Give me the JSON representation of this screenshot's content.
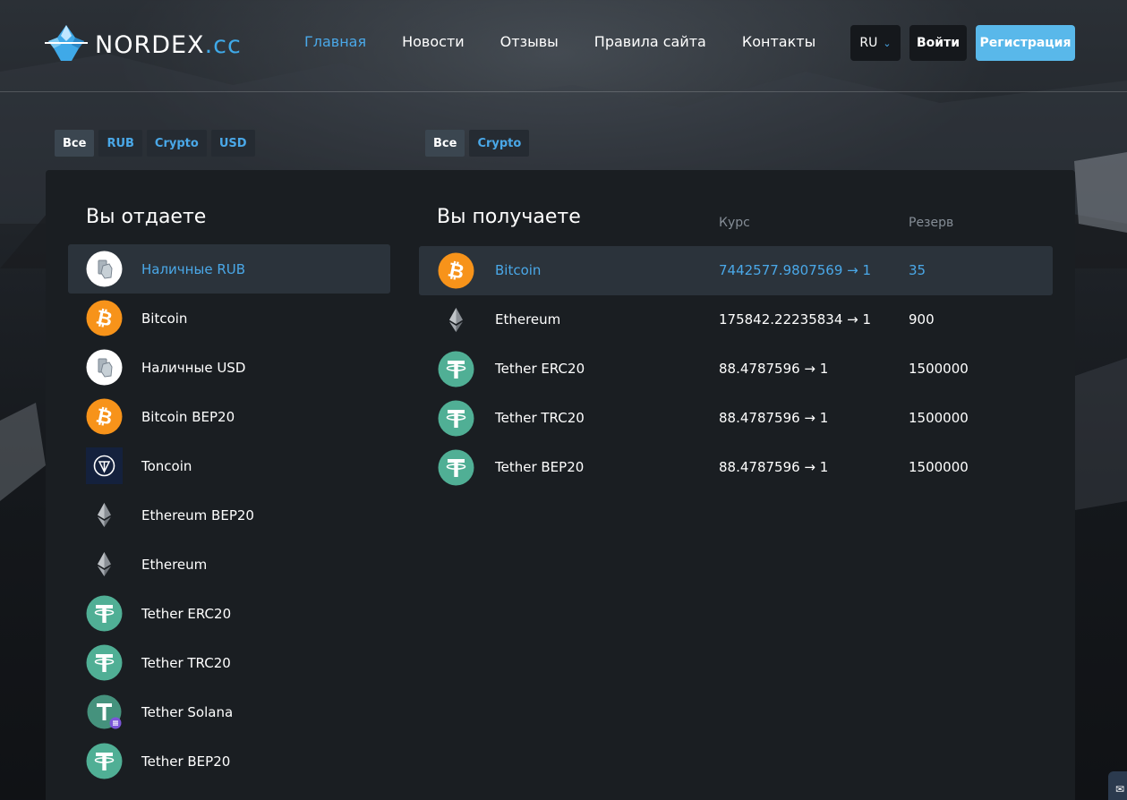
{
  "header": {
    "logo_main": "NORDEX",
    "logo_tld": ".cc",
    "nav": [
      {
        "label": "Главная",
        "active": true
      },
      {
        "label": "Новости",
        "active": false
      },
      {
        "label": "Отзывы",
        "active": false
      },
      {
        "label": "Правила сайта",
        "active": false
      },
      {
        "label": "Контакты",
        "active": false
      }
    ],
    "lang": "RU",
    "login_label": "Войти",
    "register_label": "Регистрация"
  },
  "filters_give": [
    {
      "label": "Все",
      "active": true
    },
    {
      "label": "RUB",
      "active": false
    },
    {
      "label": "Crypto",
      "active": false
    },
    {
      "label": "USD",
      "active": false
    }
  ],
  "filters_get": [
    {
      "label": "Все",
      "active": true
    },
    {
      "label": "Crypto",
      "active": false
    }
  ],
  "give": {
    "title": "Вы отдаете",
    "items": [
      {
        "name": "Наличные RUB",
        "icon": "cash-icon",
        "selected": true
      },
      {
        "name": "Bitcoin",
        "icon": "bitcoin-icon",
        "selected": false
      },
      {
        "name": "Наличные USD",
        "icon": "cash-icon",
        "selected": false
      },
      {
        "name": "Bitcoin BEP20",
        "icon": "bitcoin-icon",
        "selected": false
      },
      {
        "name": "Toncoin",
        "icon": "toncoin-icon",
        "selected": false
      },
      {
        "name": "Ethereum BEP20",
        "icon": "ethereum-icon",
        "selected": false
      },
      {
        "name": "Ethereum",
        "icon": "ethereum-icon",
        "selected": false
      },
      {
        "name": "Tether ERC20",
        "icon": "tether-icon",
        "selected": false
      },
      {
        "name": "Tether TRC20",
        "icon": "tether-icon",
        "selected": false
      },
      {
        "name": "Tether Solana",
        "icon": "tether-solana-icon",
        "selected": false
      },
      {
        "name": "Tether BEP20",
        "icon": "tether-icon",
        "selected": false
      }
    ]
  },
  "get": {
    "title": "Вы получаете",
    "rate_header": "Курс",
    "reserve_header": "Резерв",
    "items": [
      {
        "name": "Bitcoin",
        "icon": "bitcoin-icon",
        "rate": "7442577.9807569 → 1",
        "reserve": "35",
        "selected": true
      },
      {
        "name": "Ethereum",
        "icon": "ethereum-icon",
        "rate": "175842.22235834 → 1",
        "reserve": "900",
        "selected": false
      },
      {
        "name": "Tether ERC20",
        "icon": "tether-icon",
        "rate": "88.4787596 → 1",
        "reserve": "1500000",
        "selected": false
      },
      {
        "name": "Tether TRC20",
        "icon": "tether-icon",
        "rate": "88.4787596 → 1",
        "reserve": "1500000",
        "selected": false
      },
      {
        "name": "Tether BEP20",
        "icon": "tether-icon",
        "rate": "88.4787596 → 1",
        "reserve": "1500000",
        "selected": false
      }
    ]
  },
  "colors": {
    "accent": "#4aa8e8",
    "register": "#59b8ea",
    "bitcoin": "#f7931a",
    "tether": "#50af95",
    "panel": "#1a1e22"
  }
}
